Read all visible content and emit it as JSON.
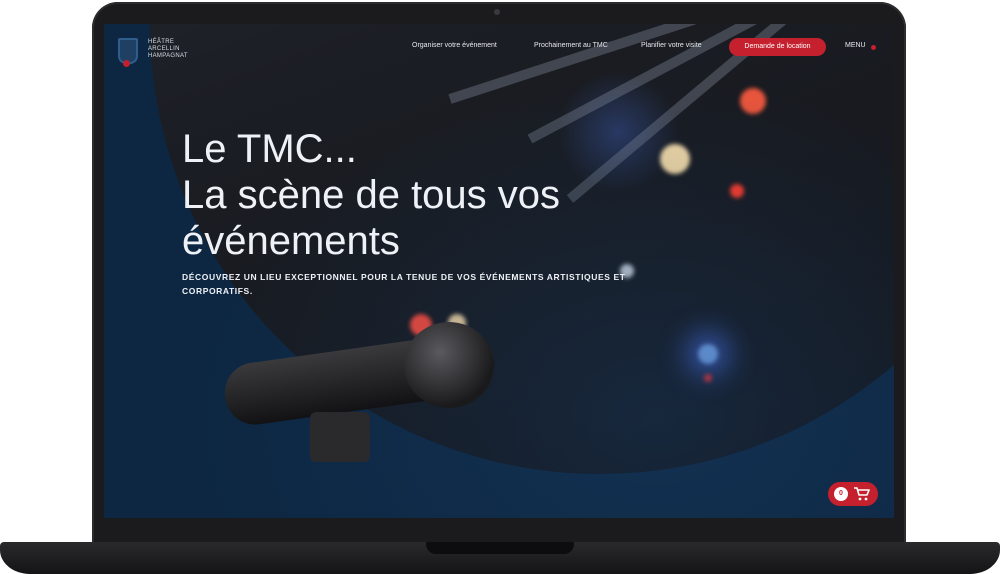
{
  "logo": {
    "lines": [
      "HÉÂTRE",
      "ARCELLIN",
      "HAMPAGNAT"
    ]
  },
  "nav": {
    "links": [
      "Organiser votre événement",
      "Prochainement au TMC",
      "Planifier votre visite"
    ],
    "cta": "Demande de location",
    "menu": "MENU"
  },
  "hero": {
    "title_line1": "Le TMC...",
    "title_line2": "La scène de tous vos",
    "title_line3": "événements",
    "subtitle": "Découvrez un lieu exceptionnel pour la tenue de vos événements artistiques et corporatifs."
  },
  "cart": {
    "count": "0"
  },
  "colors": {
    "accent": "#c5202d",
    "background": "#0d2742"
  },
  "icons": [
    "cart-icon",
    "webcam-icon",
    "logo-icon"
  ]
}
